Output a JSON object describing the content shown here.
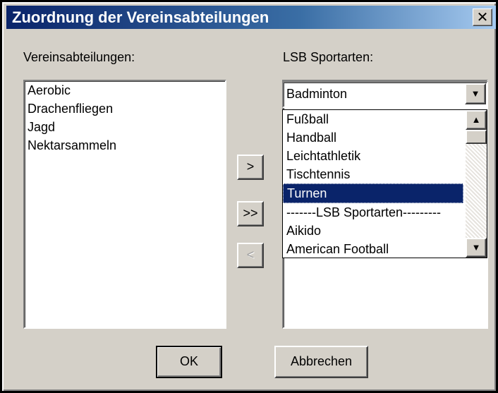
{
  "window": {
    "title": "Zuordnung der Vereinsabteilungen",
    "close_label": "✕"
  },
  "left": {
    "label": "Vereinsabteilungen:",
    "items": [
      "Aerobic",
      "Drachenfliegen",
      "Jagd",
      "Nektarsammeln"
    ]
  },
  "right": {
    "label": "LSB Sportarten:",
    "combo_value": "Badminton",
    "dropdown_items": [
      "Fußball",
      "Handball",
      "Leichtathletik",
      "Tischtennis",
      "Turnen",
      "-------LSB Sportarten---------",
      "Aikido",
      "American Football"
    ],
    "selected_item": "Turnen"
  },
  "transfer": {
    "move_right": ">",
    "move_all_right": ">>",
    "move_left": "<"
  },
  "footer": {
    "ok": "OK",
    "cancel": "Abbrechen"
  }
}
